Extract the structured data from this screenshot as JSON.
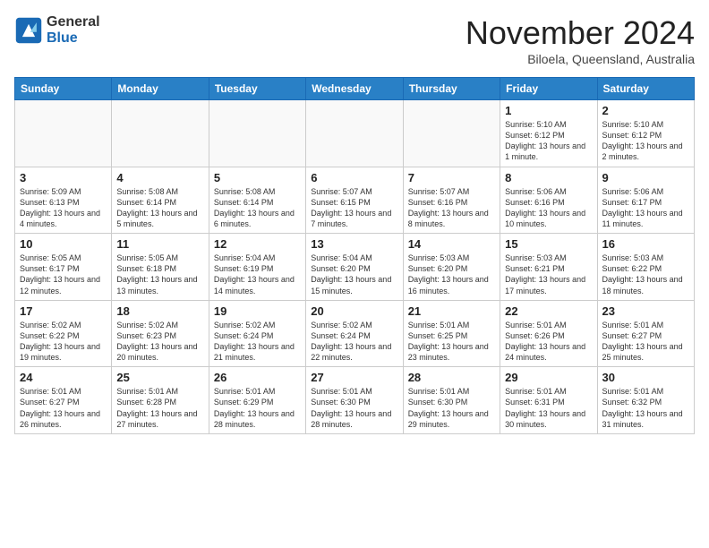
{
  "logo": {
    "general": "General",
    "blue": "Blue"
  },
  "header": {
    "month": "November 2024",
    "location": "Biloela, Queensland, Australia"
  },
  "weekdays": [
    "Sunday",
    "Monday",
    "Tuesday",
    "Wednesday",
    "Thursday",
    "Friday",
    "Saturday"
  ],
  "weeks": [
    [
      {
        "day": "",
        "info": ""
      },
      {
        "day": "",
        "info": ""
      },
      {
        "day": "",
        "info": ""
      },
      {
        "day": "",
        "info": ""
      },
      {
        "day": "",
        "info": ""
      },
      {
        "day": "1",
        "info": "Sunrise: 5:10 AM\nSunset: 6:12 PM\nDaylight: 13 hours and 1 minute."
      },
      {
        "day": "2",
        "info": "Sunrise: 5:10 AM\nSunset: 6:12 PM\nDaylight: 13 hours and 2 minutes."
      }
    ],
    [
      {
        "day": "3",
        "info": "Sunrise: 5:09 AM\nSunset: 6:13 PM\nDaylight: 13 hours and 4 minutes."
      },
      {
        "day": "4",
        "info": "Sunrise: 5:08 AM\nSunset: 6:14 PM\nDaylight: 13 hours and 5 minutes."
      },
      {
        "day": "5",
        "info": "Sunrise: 5:08 AM\nSunset: 6:14 PM\nDaylight: 13 hours and 6 minutes."
      },
      {
        "day": "6",
        "info": "Sunrise: 5:07 AM\nSunset: 6:15 PM\nDaylight: 13 hours and 7 minutes."
      },
      {
        "day": "7",
        "info": "Sunrise: 5:07 AM\nSunset: 6:16 PM\nDaylight: 13 hours and 8 minutes."
      },
      {
        "day": "8",
        "info": "Sunrise: 5:06 AM\nSunset: 6:16 PM\nDaylight: 13 hours and 10 minutes."
      },
      {
        "day": "9",
        "info": "Sunrise: 5:06 AM\nSunset: 6:17 PM\nDaylight: 13 hours and 11 minutes."
      }
    ],
    [
      {
        "day": "10",
        "info": "Sunrise: 5:05 AM\nSunset: 6:17 PM\nDaylight: 13 hours and 12 minutes."
      },
      {
        "day": "11",
        "info": "Sunrise: 5:05 AM\nSunset: 6:18 PM\nDaylight: 13 hours and 13 minutes."
      },
      {
        "day": "12",
        "info": "Sunrise: 5:04 AM\nSunset: 6:19 PM\nDaylight: 13 hours and 14 minutes."
      },
      {
        "day": "13",
        "info": "Sunrise: 5:04 AM\nSunset: 6:20 PM\nDaylight: 13 hours and 15 minutes."
      },
      {
        "day": "14",
        "info": "Sunrise: 5:03 AM\nSunset: 6:20 PM\nDaylight: 13 hours and 16 minutes."
      },
      {
        "day": "15",
        "info": "Sunrise: 5:03 AM\nSunset: 6:21 PM\nDaylight: 13 hours and 17 minutes."
      },
      {
        "day": "16",
        "info": "Sunrise: 5:03 AM\nSunset: 6:22 PM\nDaylight: 13 hours and 18 minutes."
      }
    ],
    [
      {
        "day": "17",
        "info": "Sunrise: 5:02 AM\nSunset: 6:22 PM\nDaylight: 13 hours and 19 minutes."
      },
      {
        "day": "18",
        "info": "Sunrise: 5:02 AM\nSunset: 6:23 PM\nDaylight: 13 hours and 20 minutes."
      },
      {
        "day": "19",
        "info": "Sunrise: 5:02 AM\nSunset: 6:24 PM\nDaylight: 13 hours and 21 minutes."
      },
      {
        "day": "20",
        "info": "Sunrise: 5:02 AM\nSunset: 6:24 PM\nDaylight: 13 hours and 22 minutes."
      },
      {
        "day": "21",
        "info": "Sunrise: 5:01 AM\nSunset: 6:25 PM\nDaylight: 13 hours and 23 minutes."
      },
      {
        "day": "22",
        "info": "Sunrise: 5:01 AM\nSunset: 6:26 PM\nDaylight: 13 hours and 24 minutes."
      },
      {
        "day": "23",
        "info": "Sunrise: 5:01 AM\nSunset: 6:27 PM\nDaylight: 13 hours and 25 minutes."
      }
    ],
    [
      {
        "day": "24",
        "info": "Sunrise: 5:01 AM\nSunset: 6:27 PM\nDaylight: 13 hours and 26 minutes."
      },
      {
        "day": "25",
        "info": "Sunrise: 5:01 AM\nSunset: 6:28 PM\nDaylight: 13 hours and 27 minutes."
      },
      {
        "day": "26",
        "info": "Sunrise: 5:01 AM\nSunset: 6:29 PM\nDaylight: 13 hours and 28 minutes."
      },
      {
        "day": "27",
        "info": "Sunrise: 5:01 AM\nSunset: 6:30 PM\nDaylight: 13 hours and 28 minutes."
      },
      {
        "day": "28",
        "info": "Sunrise: 5:01 AM\nSunset: 6:30 PM\nDaylight: 13 hours and 29 minutes."
      },
      {
        "day": "29",
        "info": "Sunrise: 5:01 AM\nSunset: 6:31 PM\nDaylight: 13 hours and 30 minutes."
      },
      {
        "day": "30",
        "info": "Sunrise: 5:01 AM\nSunset: 6:32 PM\nDaylight: 13 hours and 31 minutes."
      }
    ]
  ]
}
